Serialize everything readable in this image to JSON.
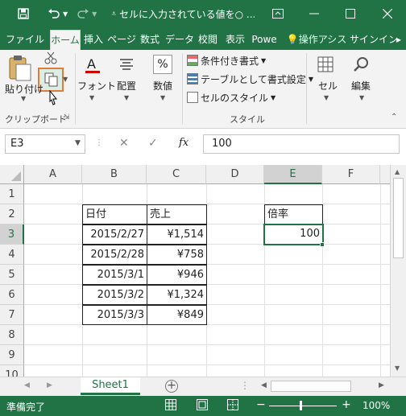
{
  "titlebar": {
    "doc_title": "セルに入力されている値を○ ...",
    "save_icon": "save-icon",
    "undo_icon": "undo-icon",
    "redo_icon": "redo-icon"
  },
  "tabs": [
    {
      "label": "ファイル"
    },
    {
      "label": "ホーム"
    },
    {
      "label": "挿入"
    },
    {
      "label": "ページ"
    },
    {
      "label": "数式"
    },
    {
      "label": "データ"
    },
    {
      "label": "校閲"
    },
    {
      "label": "表示"
    },
    {
      "label": "Powe"
    },
    {
      "label": "操作アシス"
    },
    {
      "label": "サインイン"
    }
  ],
  "ribbon": {
    "paste_label": "貼り付け",
    "clipboard_group": "クリップボード",
    "font_label": "フォント",
    "align_label": "配置",
    "number_label": "数値",
    "cond_format": "条件付き書式",
    "table_format": "テーブルとして書式設定",
    "cell_style": "セルのスタイル",
    "style_group": "スタイル",
    "cells_label": "セル",
    "edit_label": "編集"
  },
  "formula_bar": {
    "name_box": "E3",
    "fx": "fx",
    "value": "100"
  },
  "grid": {
    "columns": [
      "A",
      "B",
      "C",
      "D",
      "E",
      "F"
    ],
    "rows": [
      "1",
      "2",
      "3",
      "4",
      "5",
      "6",
      "7",
      "8",
      "9",
      "10"
    ],
    "header_date": "日付",
    "header_sales": "売上",
    "header_rate": "倍率",
    "rate_value": "100",
    "data": [
      {
        "date": "2015/2/27",
        "sales": "¥1,514"
      },
      {
        "date": "2015/2/28",
        "sales": "¥758"
      },
      {
        "date": "2015/3/1",
        "sales": "¥946"
      },
      {
        "date": "2015/3/2",
        "sales": "¥1,324"
      },
      {
        "date": "2015/3/3",
        "sales": "¥849"
      }
    ]
  },
  "sheets": {
    "active": "Sheet1"
  },
  "status": {
    "mode": "準備完了",
    "zoom": "100%"
  },
  "colors": {
    "brand": "#217346",
    "selection": "#217346",
    "highlight_box": "#e07b39"
  }
}
